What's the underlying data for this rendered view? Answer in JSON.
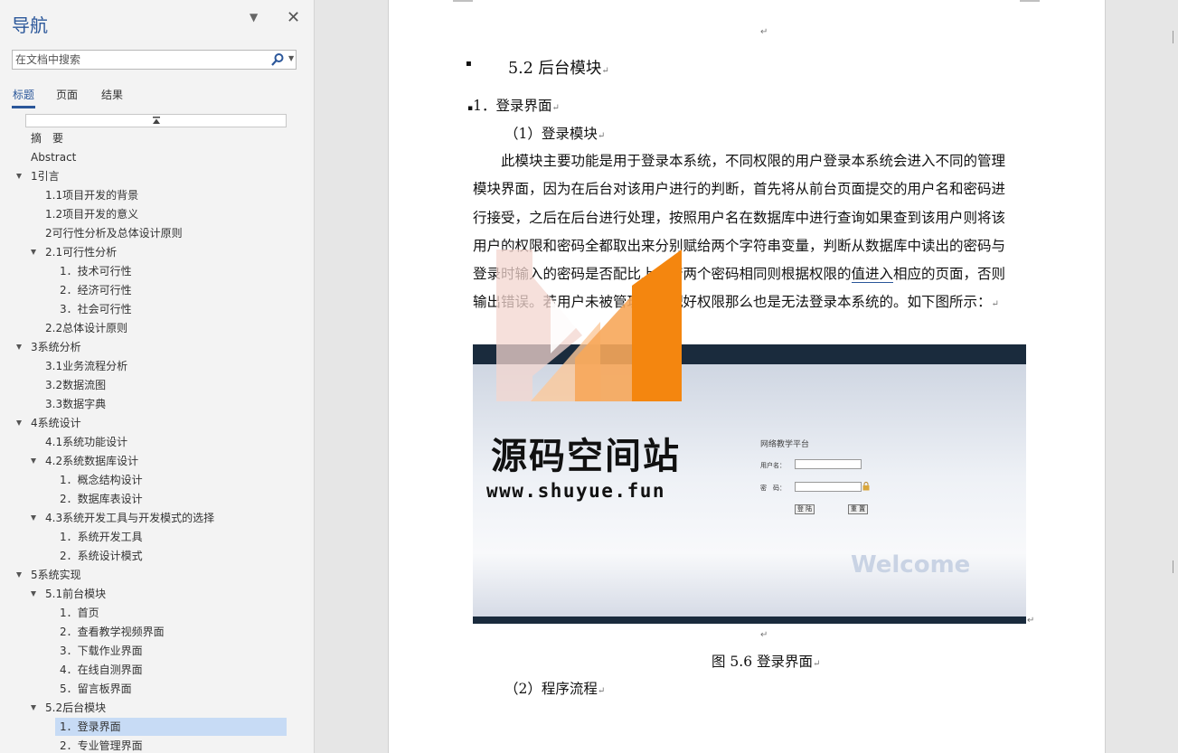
{
  "nav": {
    "title": "导航",
    "search_placeholder": "在文档中搜索",
    "tabs": [
      "标题",
      "页面",
      "结果"
    ]
  },
  "tree": [
    {
      "label": "摘　要",
      "level": 0,
      "arrow": false
    },
    {
      "label": "Abstract",
      "level": 0,
      "arrow": false
    },
    {
      "label": "1引言",
      "level": 0,
      "arrow": true
    },
    {
      "label": "1.1项目开发的背景",
      "level": 1,
      "arrow": false
    },
    {
      "label": "1.2项目开发的意义",
      "level": 1,
      "arrow": false
    },
    {
      "label": "2可行性分析及总体设计原则",
      "level": 1,
      "arrow": false
    },
    {
      "label": "2.1可行性分析",
      "level": 1,
      "arrow": true
    },
    {
      "label": "1．技术可行性",
      "level": 2,
      "arrow": false
    },
    {
      "label": "2．经济可行性",
      "level": 2,
      "arrow": false
    },
    {
      "label": "3．社会可行性",
      "level": 2,
      "arrow": false
    },
    {
      "label": "2.2总体设计原则",
      "level": 1,
      "arrow": false
    },
    {
      "label": "3系统分析",
      "level": 0,
      "arrow": true
    },
    {
      "label": "3.1业务流程分析",
      "level": 1,
      "arrow": false
    },
    {
      "label": "3.2数据流图",
      "level": 1,
      "arrow": false
    },
    {
      "label": "3.3数据字典",
      "level": 1,
      "arrow": false
    },
    {
      "label": "4系统设计",
      "level": 0,
      "arrow": true
    },
    {
      "label": "4.1系统功能设计",
      "level": 1,
      "arrow": false
    },
    {
      "label": "4.2系统数据库设计",
      "level": 1,
      "arrow": true
    },
    {
      "label": "1．概念结构设计",
      "level": 2,
      "arrow": false
    },
    {
      "label": "2．数据库表设计",
      "level": 2,
      "arrow": false
    },
    {
      "label": "4.3系统开发工具与开发模式的选择",
      "level": 1,
      "arrow": true
    },
    {
      "label": "1．系统开发工具",
      "level": 2,
      "arrow": false
    },
    {
      "label": "2．系统设计模式",
      "level": 2,
      "arrow": false
    },
    {
      "label": "5系统实现",
      "level": 0,
      "arrow": true
    },
    {
      "label": "5.1前台模块",
      "level": 1,
      "arrow": true
    },
    {
      "label": "1．首页",
      "level": 2,
      "arrow": false
    },
    {
      "label": "2．查看教学视频界面",
      "level": 2,
      "arrow": false
    },
    {
      "label": "3．下载作业界面",
      "level": 2,
      "arrow": false
    },
    {
      "label": "4．在线自测界面",
      "level": 2,
      "arrow": false
    },
    {
      "label": "5．留言板界面",
      "level": 2,
      "arrow": false
    },
    {
      "label": "5.2后台模块",
      "level": 1,
      "arrow": true
    },
    {
      "label": "1．登录界面",
      "level": 2,
      "arrow": false,
      "selected": true
    },
    {
      "label": "2．专业管理界面",
      "level": 2,
      "arrow": false
    }
  ],
  "doc": {
    "heading": "5.2 后台模块",
    "subheading": "1．登录界面",
    "sub2": "（1）登录模块",
    "para_lines": [
      "　　此模块主要功能是用于登录本系统，不同权限的用户登录本系统会进入不同的管理",
      "模块界面，因为在后台对该用户进行的判断，首先将从前台页面提交的用户名和密码进",
      "行接受，之后在后台进行处理，按照用户名在数据库中进行查询如果查到该用户则将该",
      "用户的权限和密码全都取出来分别赋给两个字符串变量，判断从数据库中读出的密码与",
      "登录时输入的密码是否配比上，若两个密码相同则根据权限的",
      "输出错误。若用户未被管理员分配好权限那么也是无法登录本系统的。如下图所示："
    ],
    "para_underline": "值进入",
    "para_line5_tail": "相应的页面，否则",
    "caption": "图 5.6 登录界面",
    "sub3": "（2）程序流程",
    "para_mark": "↵"
  },
  "figure": {
    "title": "网络教学平台",
    "username_label": "用户名：",
    "password_label": "密　码：",
    "login_btn": "登 陆",
    "reset_btn": "重 置",
    "welcome": "Welcome"
  },
  "watermark": {
    "name": "源码空间站",
    "url": "www.shuyue.fun"
  }
}
